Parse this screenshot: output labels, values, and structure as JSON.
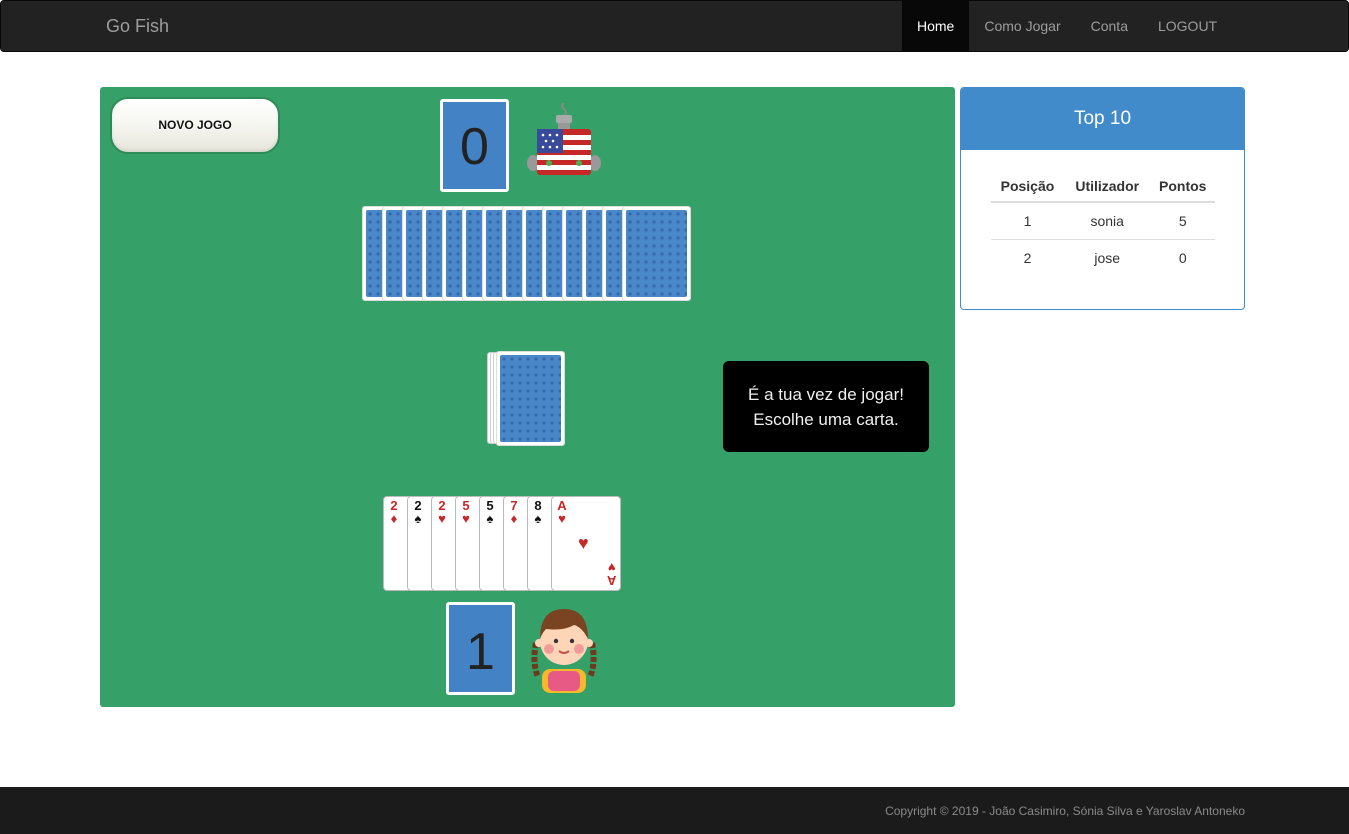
{
  "navbar": {
    "brand": "Go Fish",
    "items": [
      {
        "label": "Home",
        "active": true
      },
      {
        "label": "Como Jogar",
        "active": false
      },
      {
        "label": "Conta",
        "active": false
      },
      {
        "label": "LOGOUT",
        "active": false
      }
    ]
  },
  "game": {
    "new_game_label": "NOVO JOGO",
    "opponent": {
      "score": "0",
      "avatar": "robot-flag-icon",
      "hand_count": 14
    },
    "deck": {
      "icon": "card-back"
    },
    "message": {
      "line1": "É a tua vez de jogar!",
      "line2": "Escolhe uma carta."
    },
    "player": {
      "score": "1",
      "avatar": "girl-avatar-icon",
      "hand": [
        {
          "rank": "2",
          "suit": "♦",
          "color": "red"
        },
        {
          "rank": "2",
          "suit": "♠",
          "color": "black"
        },
        {
          "rank": "2",
          "suit": "♥",
          "color": "red"
        },
        {
          "rank": "5",
          "suit": "♥",
          "color": "red"
        },
        {
          "rank": "5",
          "suit": "♠",
          "color": "black"
        },
        {
          "rank": "7",
          "suit": "♦",
          "color": "red"
        },
        {
          "rank": "8",
          "suit": "♠",
          "color": "black"
        },
        {
          "rank": "A",
          "suit": "♥",
          "color": "red"
        }
      ]
    },
    "colors": {
      "felt": "#35a168",
      "score_box": "#4282c5",
      "card_back": "#4a87c9"
    }
  },
  "leaderboard": {
    "title": "Top 10",
    "columns": [
      "Posição",
      "Utilizador",
      "Pontos"
    ],
    "rows": [
      {
        "pos": "1",
        "user": "sonia",
        "points": "5"
      },
      {
        "pos": "2",
        "user": "jose",
        "points": "0"
      }
    ]
  },
  "footer": {
    "copyright": "Copyright © 2019 - João Casimiro, Sónia Silva e Yaroslav Antoneko"
  }
}
